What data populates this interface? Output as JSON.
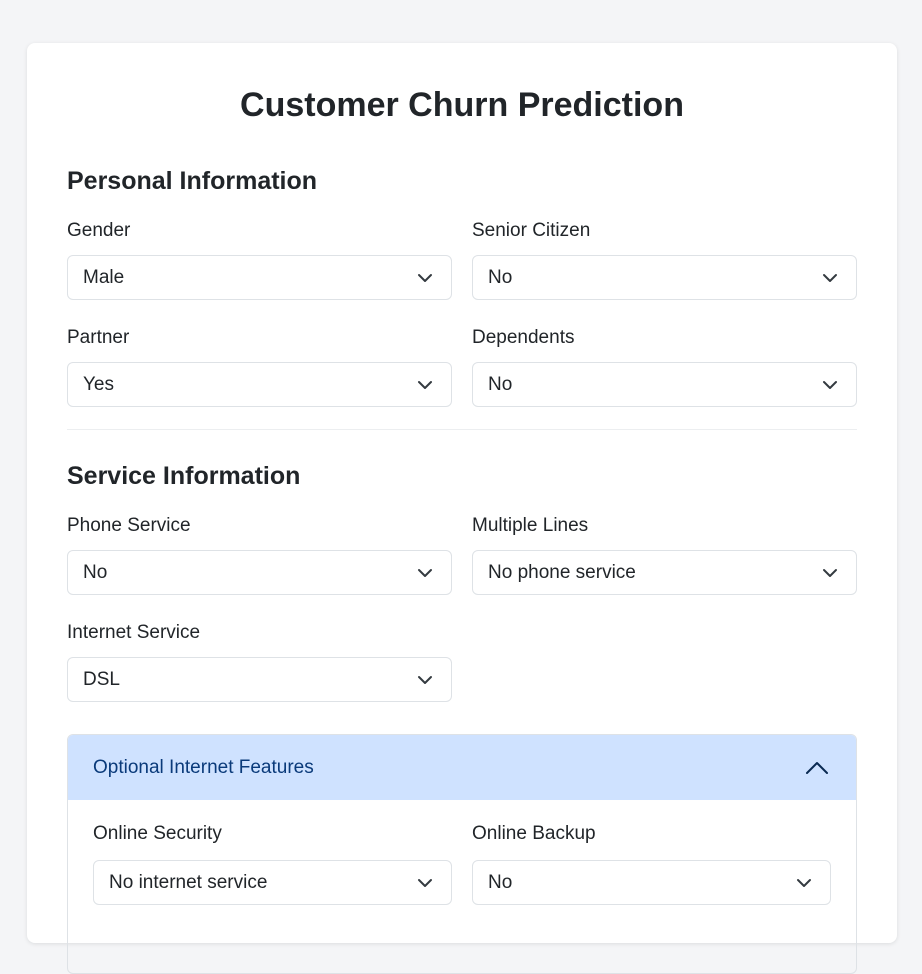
{
  "title": "Customer Churn Prediction",
  "personal": {
    "heading": "Personal Information",
    "gender": {
      "label": "Gender",
      "value": "Male"
    },
    "senior_citizen": {
      "label": "Senior Citizen",
      "value": "No"
    },
    "partner": {
      "label": "Partner",
      "value": "Yes"
    },
    "dependents": {
      "label": "Dependents",
      "value": "No"
    }
  },
  "service": {
    "heading": "Service Information",
    "phone_service": {
      "label": "Phone Service",
      "value": "No"
    },
    "multiple_lines": {
      "label": "Multiple Lines",
      "value": "No phone service"
    },
    "internet_service": {
      "label": "Internet Service",
      "value": "DSL"
    }
  },
  "optional": {
    "heading": "Optional Internet Features",
    "online_security": {
      "label": "Online Security",
      "value": "No internet service"
    },
    "online_backup": {
      "label": "Online Backup",
      "value": "No"
    }
  },
  "icons": {
    "select_chevron": "chevron-down-icon",
    "accordion_chevron": "chevron-up-icon"
  },
  "colors": {
    "accordion_header_bg": "#cfe2ff",
    "accordion_header_text": "#0a3a7a"
  }
}
